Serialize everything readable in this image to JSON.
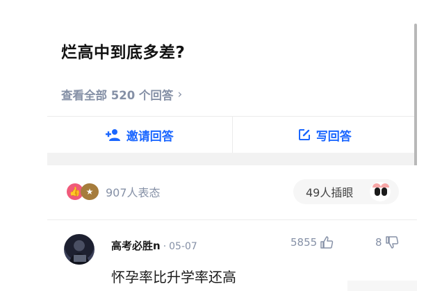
{
  "question": {
    "title": "烂高中到底多差?",
    "view_all": "查看全部 520 个回答",
    "view_all_chevron": "›"
  },
  "actions": {
    "invite": {
      "label": "邀请回答",
      "icon": "add-user-icon"
    },
    "write": {
      "label": "写回答",
      "icon": "edit-icon"
    }
  },
  "reactions": {
    "summary": "907人表态",
    "pill_label": "49人插眼",
    "icons": [
      "like-heart-icon",
      "gold-badge-icon",
      "eyes-emoji-icon"
    ]
  },
  "comment": {
    "author": "高考必胜n",
    "separator": "·",
    "date": "05-07",
    "likes": "5855",
    "dislikes": "8",
    "text": "怀孕率比升学率还高"
  },
  "colors": {
    "accent": "#1a66ff",
    "muted": "#8590a6",
    "band": "#f2f2f2"
  }
}
